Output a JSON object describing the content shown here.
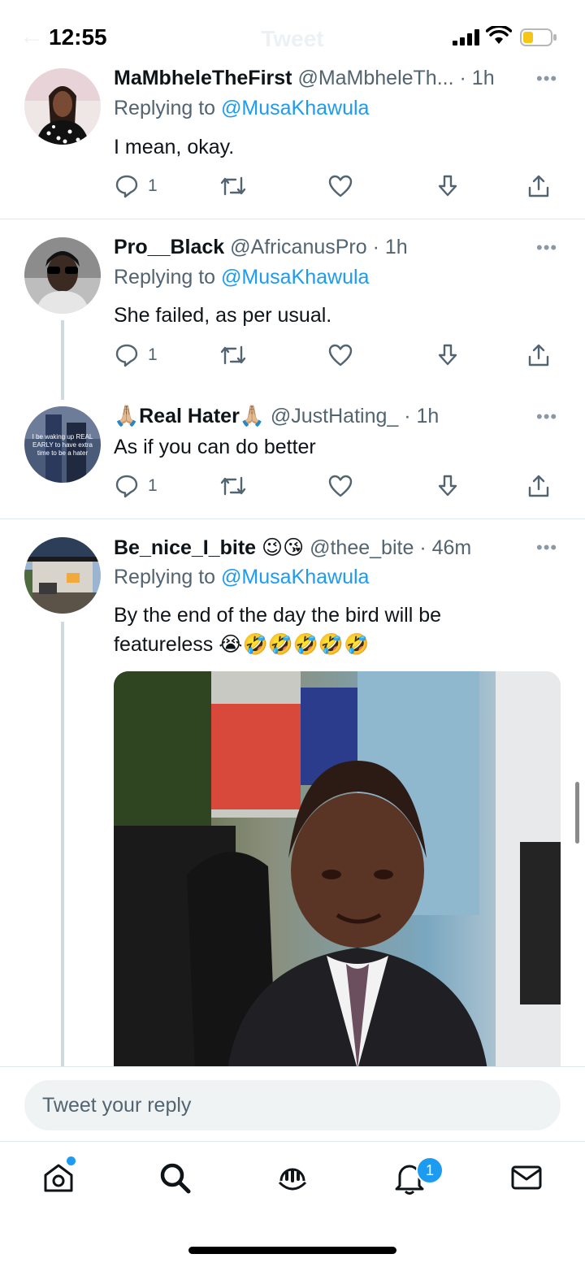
{
  "status_bar": {
    "time": "12:55",
    "ghost_title": "Tweet"
  },
  "tweets": [
    {
      "name": "MaMbheleTheFirst",
      "handle": "@MaMbheleTh...",
      "time": "· 1h",
      "reply_prefix": "Replying to",
      "reply_to": "@MusaKhawula",
      "text": "I mean, okay.",
      "reply_count": "1"
    },
    {
      "name": "Pro__Black",
      "handle": "@AfricanusPro",
      "time": "· 1h",
      "reply_prefix": "Replying to",
      "reply_to": "@MusaKhawula",
      "text": "She failed, as per usual.",
      "reply_count": "1"
    },
    {
      "name": "🙏🏼Real Hater🙏🏼",
      "handle": "@JustHating_",
      "time": "· 1h",
      "text": "As if you can do better",
      "reply_count": "1",
      "avatar_caption": "I be waking up REAL EARLY to have extra time to be a hater"
    },
    {
      "name": "Be_nice_I_bite 😉😘",
      "handle": "@thee_bite",
      "time": "· 46m",
      "reply_prefix": "Replying to",
      "reply_to": "@MusaKhawula",
      "text_line1": "By the end of the day the bird will be",
      "text_line2": "featureless 😭🤣🤣🤣🤣🤣"
    }
  ],
  "reply_bar": {
    "placeholder": "Tweet your reply"
  },
  "tabbar": {
    "notifications_badge": "1"
  },
  "icons": [
    "reply-icon",
    "retweet-icon",
    "like-icon",
    "download-icon",
    "share-icon",
    "more-icon",
    "home-icon",
    "search-icon",
    "spaces-icon",
    "notifications-icon",
    "messages-icon"
  ],
  "colors": {
    "accent": "#1d9bf0",
    "text": "#0f1419",
    "secondary": "#536471"
  }
}
